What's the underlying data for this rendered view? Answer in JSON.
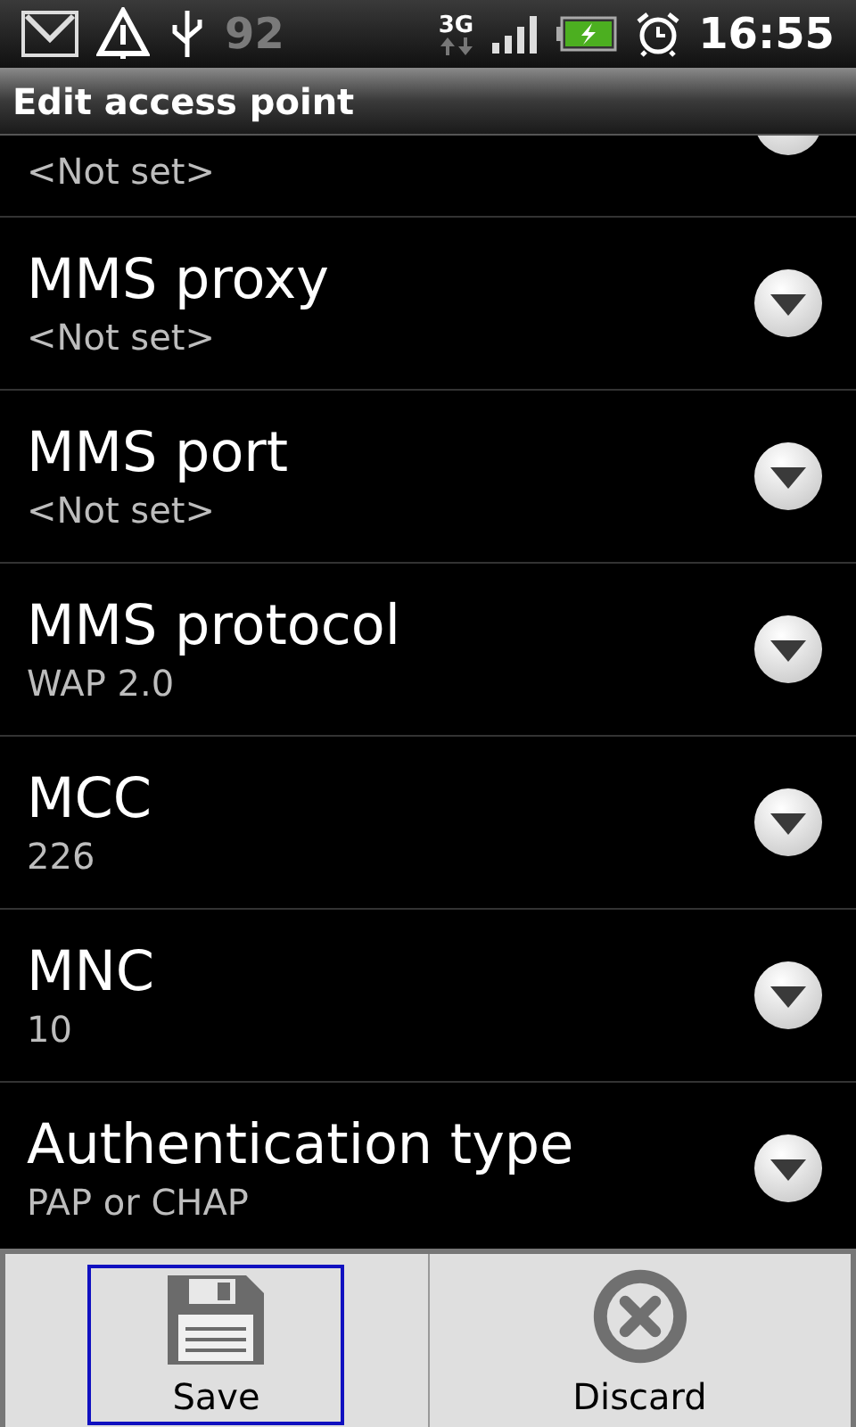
{
  "status_bar": {
    "notification_text": "92",
    "network": "3G",
    "time": "16:55"
  },
  "title_bar": {
    "title": "Edit access point"
  },
  "settings": [
    {
      "value": "<Not set>",
      "kind": "partial"
    },
    {
      "title": "MMS proxy",
      "value": "<Not set>",
      "kind": "full"
    },
    {
      "title": "MMS port",
      "value": "<Not set>",
      "kind": "full"
    },
    {
      "title": "MMS protocol",
      "value": "WAP 2.0",
      "kind": "full"
    },
    {
      "title": "MCC",
      "value": "226",
      "kind": "full"
    },
    {
      "title": "MNC",
      "value": "10",
      "kind": "full"
    },
    {
      "title": "Authentication type",
      "value": "PAP or CHAP",
      "kind": "full"
    }
  ],
  "bottom_bar": {
    "buttons": [
      {
        "label": "Save",
        "kind": "save",
        "selected": true
      },
      {
        "label": "Discard",
        "kind": "discard",
        "selected": false
      }
    ]
  }
}
